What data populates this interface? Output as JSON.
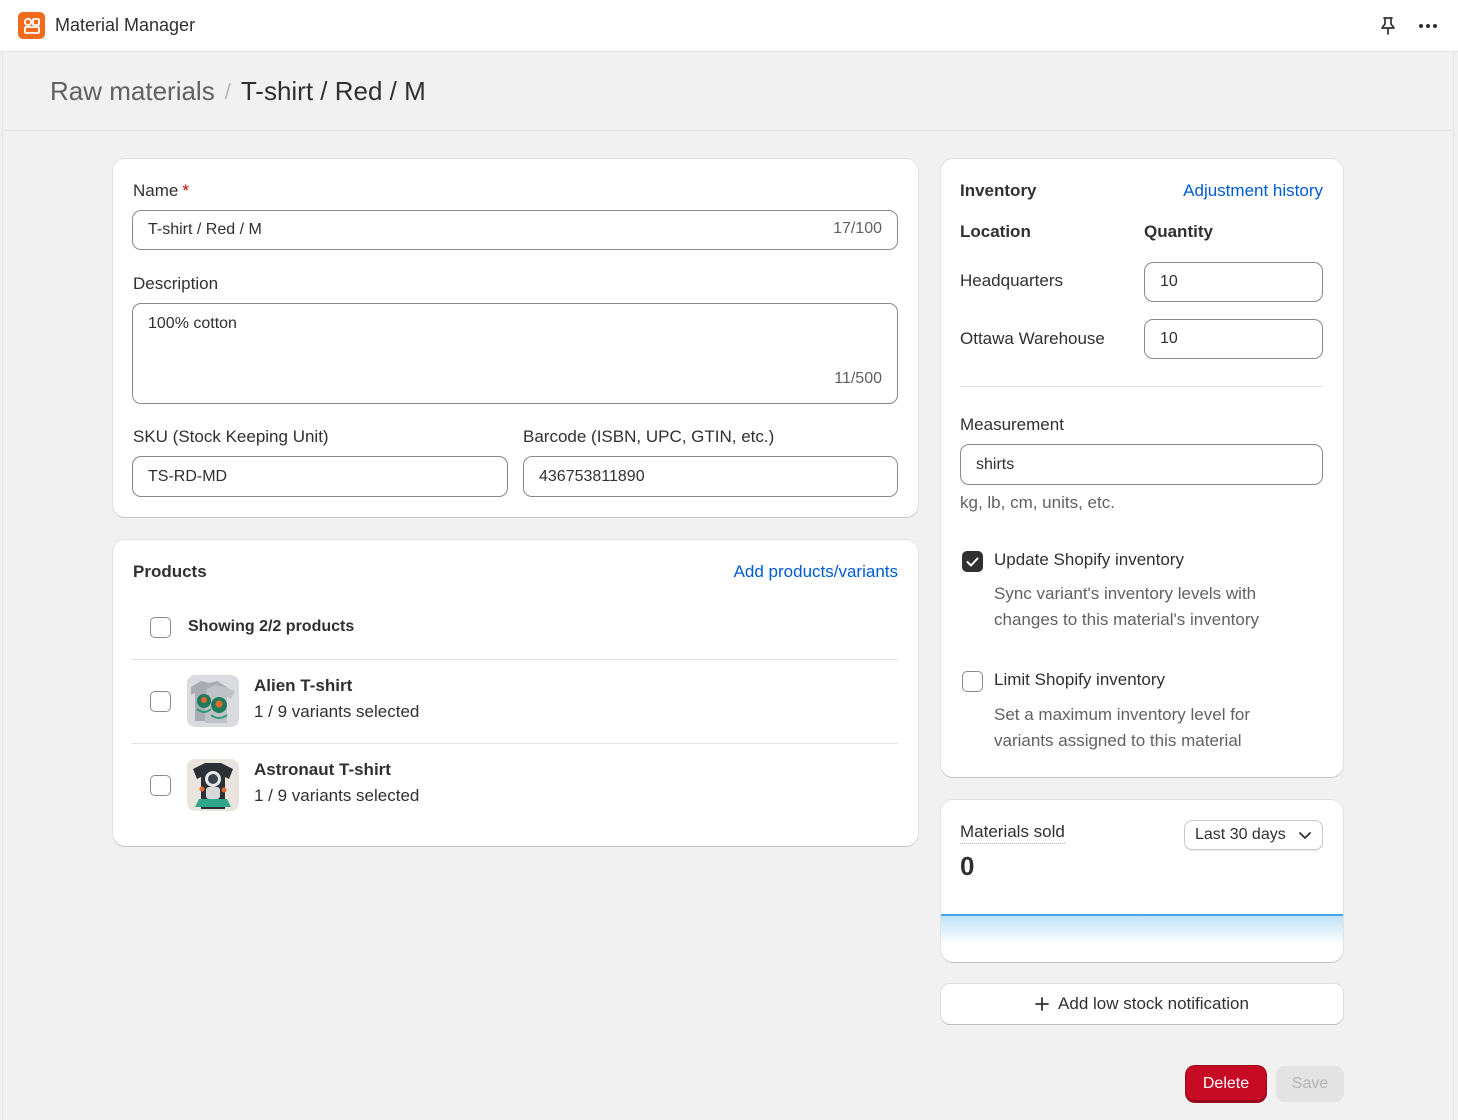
{
  "app": {
    "title": "Material Manager"
  },
  "breadcrumb": {
    "parent": "Raw materials",
    "separator": "/",
    "current": "T-shirt / Red / M"
  },
  "details": {
    "name_label": "Name",
    "name_required": "*",
    "name_value": "T-shirt / Red / M",
    "name_counter": "17/100",
    "description_label": "Description",
    "description_value": "100% cotton",
    "description_counter": "11/500",
    "sku_label": "SKU (Stock Keeping Unit)",
    "sku_value": "TS-RD-MD",
    "barcode_label": "Barcode (ISBN, UPC, GTIN, etc.)",
    "barcode_value": "436753811890"
  },
  "products": {
    "title": "Products",
    "add_link": "Add products/variants",
    "showing": "Showing 2/2 products",
    "items": [
      {
        "name": "Alien T-shirt",
        "variants": "1 / 9 variants selected"
      },
      {
        "name": "Astronaut T-shirt",
        "variants": "1 / 9 variants selected"
      }
    ]
  },
  "inventory": {
    "title": "Inventory",
    "history_link": "Adjustment history",
    "location_header": "Location",
    "quantity_header": "Quantity",
    "locations": [
      {
        "name": "Headquarters",
        "quantity": "10"
      },
      {
        "name": "Ottawa Warehouse",
        "quantity": "10"
      }
    ],
    "measurement_label": "Measurement",
    "measurement_value": "shirts",
    "measurement_help": "kg, lb, cm, units, etc.",
    "update_label": "Update Shopify inventory",
    "update_help": "Sync variant's inventory levels with changes to this material's inventory",
    "update_checked": true,
    "limit_label": "Limit Shopify inventory",
    "limit_help": "Set a maximum inventory level for variants assigned to this material",
    "limit_checked": false
  },
  "materials_sold": {
    "title": "Materials sold",
    "value": "0",
    "range": "Last 30 days"
  },
  "notification": {
    "add_label": "Add low stock notification"
  },
  "actions": {
    "delete_label": "Delete",
    "save_label": "Save"
  },
  "colors": {
    "link": "#005bd3",
    "danger": "#c70a24",
    "disabled_bg": "#e3e3e3",
    "app_logo": "#f26b1d",
    "chart_line": "#4aa6e8"
  },
  "icons": [
    "app-logo-icon",
    "pin-icon",
    "more-icon",
    "check-icon",
    "chevron-down-icon",
    "plus-icon"
  ]
}
